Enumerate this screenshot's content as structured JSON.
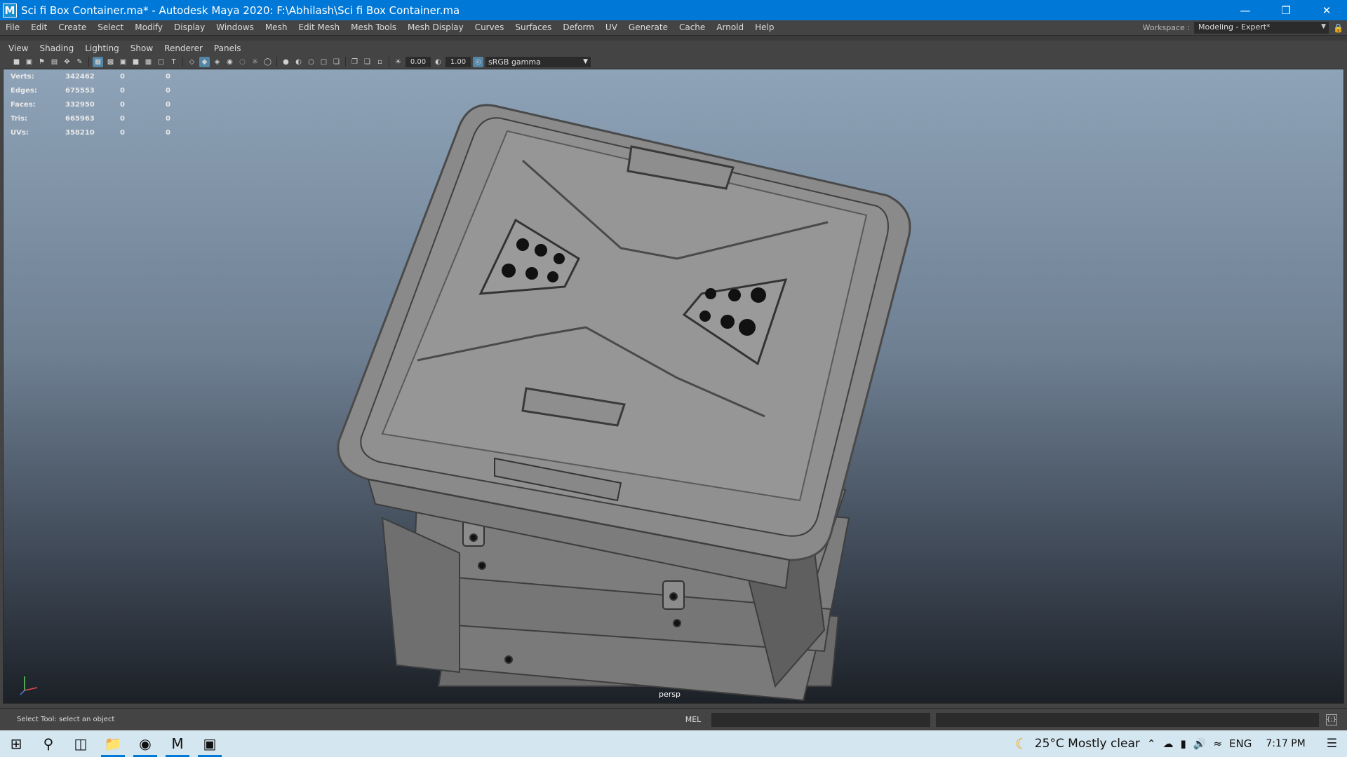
{
  "window": {
    "icon": "M",
    "title": "Sci fi Box Container.ma* - Autodesk Maya 2020: F:\\Abhilash\\Sci fi Box Container.ma",
    "controls": [
      "minimize-icon",
      "restore-icon",
      "close-icon"
    ]
  },
  "menubar": {
    "items": [
      "File",
      "Edit",
      "Create",
      "Select",
      "Modify",
      "Display",
      "Windows",
      "Mesh",
      "Edit Mesh",
      "Mesh Tools",
      "Mesh Display",
      "Curves",
      "Surfaces",
      "Deform",
      "UV",
      "Generate",
      "Cache",
      "Arnold",
      "Help"
    ],
    "workspace_label": "Workspace :",
    "workspace_value": "Modeling - Expert*"
  },
  "panel_menu": {
    "items": [
      "View",
      "Shading",
      "Lighting",
      "Show",
      "Renderer",
      "Panels"
    ]
  },
  "panel_toolbar": {
    "exposure": "0.00",
    "gamma": "1.00",
    "color_space": "sRGB gamma"
  },
  "hud": {
    "rows": [
      {
        "label": "Verts:",
        "value": "342462",
        "selected": "0",
        "component": "0"
      },
      {
        "label": "Edges:",
        "value": "675553",
        "selected": "0",
        "component": "0"
      },
      {
        "label": "Faces:",
        "value": "332950",
        "selected": "0",
        "component": "0"
      },
      {
        "label": "Tris:",
        "value": "665963",
        "selected": "0",
        "component": "0"
      },
      {
        "label": "UVs:",
        "value": "358210",
        "selected": "0",
        "component": "0"
      }
    ]
  },
  "viewport": {
    "camera": "persp"
  },
  "helpline": {
    "text": "Select Tool: select an object",
    "mel_label": "MEL"
  },
  "taskbar": {
    "weather": "25°C  Mostly clear",
    "language": "ENG",
    "time": "7:17 PM"
  },
  "colors": {
    "titlebar": "#0078d7",
    "ui_bg": "#444444",
    "highlight": "#5285a6",
    "taskbar": "#d4e6ef"
  }
}
